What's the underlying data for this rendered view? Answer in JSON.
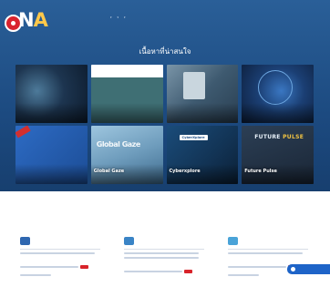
{
  "header": {
    "logo_small_text": "",
    "logo_word_prefix": "N",
    "logo_word_accent": "A",
    "logo_word_suffix": "",
    "logo_sub_text": "",
    "nav": [
      {
        "label": "",
        "has_caret": false
      },
      {
        "label": "",
        "has_caret": true
      },
      {
        "label": "",
        "has_caret": true
      },
      {
        "label": "",
        "has_caret": true
      },
      {
        "label": "",
        "has_caret": false
      },
      {
        "label": "",
        "has_caret": false
      },
      {
        "label": "",
        "has_caret": false
      }
    ]
  },
  "hero": {
    "title": "เนื้อหาที่น่าสนใจ"
  },
  "cards": [
    {
      "title": "",
      "sub": ""
    },
    {
      "title": "",
      "sub": "",
      "banner": "",
      "inner_title": "",
      "inner_sub": ""
    },
    {
      "title": "",
      "sub": ""
    },
    {
      "title": "",
      "sub": ""
    },
    {
      "title": "",
      "sub": "",
      "logo_text": "",
      "tag_text": ""
    },
    {
      "title": "Global Gaze",
      "sub": "",
      "overlay_word": "Global Gaze"
    },
    {
      "title": "Cyberxplore",
      "sub": "",
      "badge": "CyberXplore",
      "badge_sub": ""
    },
    {
      "title": "Future Pulse",
      "sub": "",
      "word_a": "FUTURE",
      "word_b": "PULSE",
      "word_sub": ""
    }
  ],
  "sections": [
    {
      "title": "",
      "icon": "megaphone-icon"
    },
    {
      "title": "",
      "icon": "newspaper-icon"
    },
    {
      "title": "",
      "icon": "announcement-icon"
    }
  ],
  "chat": {
    "label": ""
  },
  "colors": {
    "brand_blue": "#1f4f86",
    "accent_red": "#d9232e",
    "new_badge": "#d8232a",
    "chat_blue": "#1e64c8"
  }
}
